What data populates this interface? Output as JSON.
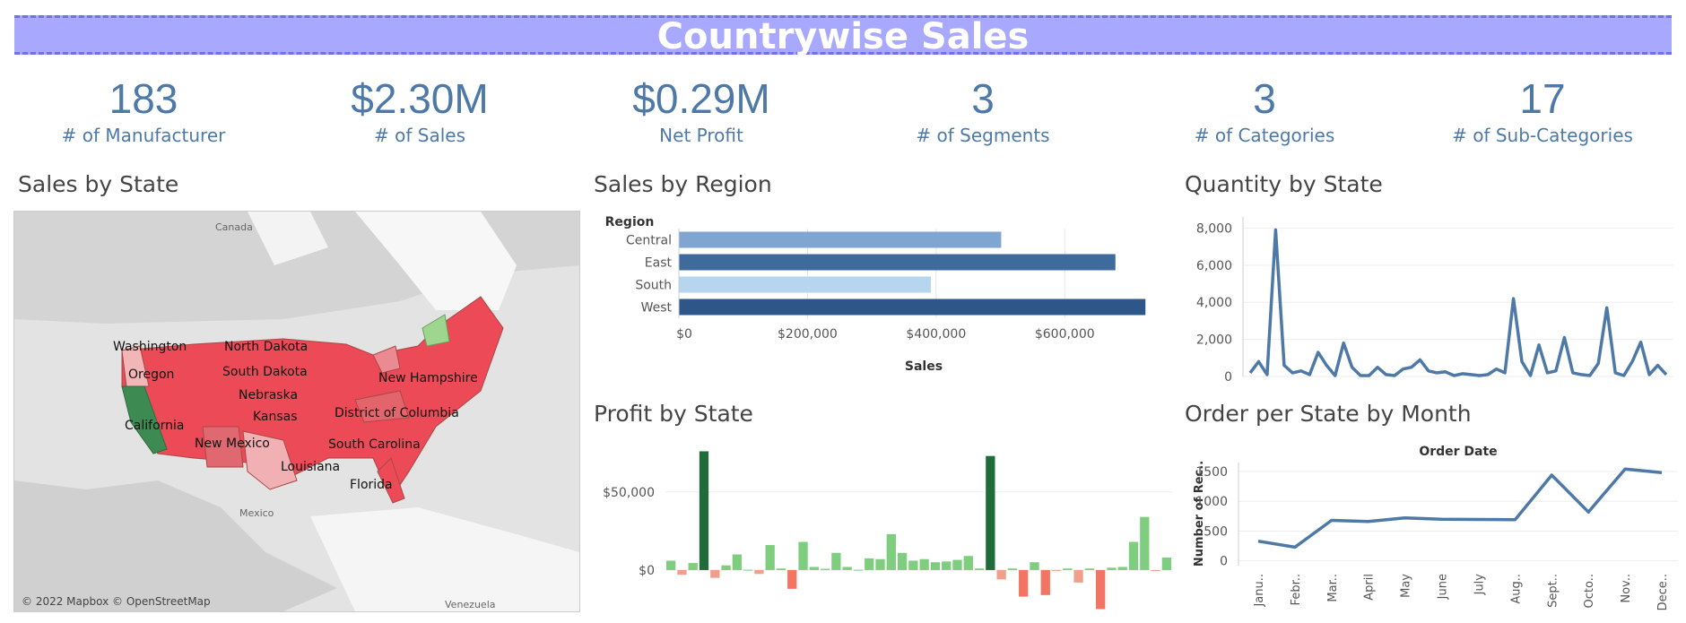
{
  "header": {
    "title": "Countrywise Sales"
  },
  "kpis": [
    {
      "value": "183",
      "label": "# of Manufacturer"
    },
    {
      "value": "$2.30M",
      "label": "# of Sales"
    },
    {
      "value": "$0.29M",
      "label": "Net Profit"
    },
    {
      "value": "3",
      "label": "# of Segments"
    },
    {
      "value": "3",
      "label": "# of Categories"
    },
    {
      "value": "17",
      "label": "# of Sub-Categories"
    }
  ],
  "sections": {
    "map": "Sales by State",
    "region": "Sales by Region",
    "quantity": "Quantity by State",
    "profit": "Profit by State",
    "orders": "Order per State by Month"
  },
  "map": {
    "country_labels": [
      "Canada",
      "Mexico",
      "Venezuela"
    ],
    "state_labels": [
      "Washington",
      "North Dakota",
      "Oregon",
      "South Dakota",
      "New Hampshire",
      "Nebraska",
      "Kansas",
      "District of Columbia",
      "California",
      "New Mexico",
      "South Carolina",
      "Louisiana",
      "Florida"
    ],
    "attribution": "© 2022 Mapbox © OpenStreetMap"
  },
  "chart_data": [
    {
      "type": "bar",
      "orientation": "horizontal",
      "categories": [
        "Central",
        "East",
        "South",
        "West"
      ],
      "values": [
        501240,
        678781,
        391722,
        725458
      ],
      "colors": [
        "#7ea6d0",
        "#3e6a9c",
        "#b6d5ee",
        "#2c5788"
      ],
      "category_header": "Region",
      "xlabel": "Sales",
      "xticks": [
        "$0",
        "$200,000",
        "$400,000",
        "$600,000"
      ],
      "xlim": [
        0,
        760000
      ]
    },
    {
      "type": "line",
      "values": [
        200,
        800,
        100,
        7900,
        600,
        200,
        300,
        100,
        1300,
        600,
        50,
        1800,
        500,
        50,
        50,
        500,
        100,
        50,
        400,
        500,
        900,
        300,
        200,
        250,
        50,
        150,
        100,
        50,
        100,
        400,
        200,
        4200,
        800,
        50,
        1700,
        200,
        300,
        2100,
        200,
        100,
        50,
        700,
        3700,
        200,
        50,
        800,
        1850,
        100,
        600,
        100
      ],
      "yticks": [
        "0",
        "2,000",
        "4,000",
        "6,000",
        "8,000"
      ],
      "ylim": [
        0,
        8600
      ],
      "color": "#4e79a7"
    },
    {
      "type": "bar",
      "values": [
        6000,
        -3000,
        4500,
        76000,
        -5000,
        3000,
        10000,
        200,
        -2500,
        16000,
        1000,
        -12000,
        18000,
        2000,
        800,
        11000,
        2000,
        200,
        7500,
        7000,
        23000,
        11000,
        6000,
        7000,
        5000,
        5500,
        6500,
        9000,
        1000,
        73000,
        -6000,
        1000,
        -17000,
        5000,
        -16000,
        -500,
        1000,
        -8000,
        1000,
        -25000,
        1500,
        2000,
        18000,
        34000,
        -500,
        8000
      ],
      "yticks": [
        "$0",
        "$50,000"
      ],
      "ylim": [
        -27000,
        82000
      ],
      "color_scale": {
        "strong_positive": "#1f6b3a",
        "positive": "#7fcd7f",
        "negative": "#f0a08a",
        "strong_negative": "#f27462"
      }
    },
    {
      "type": "line",
      "title": "Order Date",
      "ylabel": "Number of Rec..",
      "categories": [
        "January",
        "February",
        "March",
        "April",
        "May",
        "June",
        "July",
        "August",
        "September",
        "October",
        "November",
        "December"
      ],
      "tick_labels": [
        "Janu..",
        "Febr..",
        "Mar..",
        "April",
        "May",
        "June",
        "July",
        "Aug..",
        "Sept..",
        "Octo..",
        "Nov..",
        "Dece.."
      ],
      "values": [
        330,
        230,
        680,
        660,
        720,
        700,
        695,
        690,
        1440,
        820,
        1540,
        1480
      ],
      "yticks": [
        "0",
        "500",
        "1000",
        "1500"
      ],
      "ylim": [
        -80,
        1650
      ],
      "color": "#4e79a7"
    }
  ]
}
